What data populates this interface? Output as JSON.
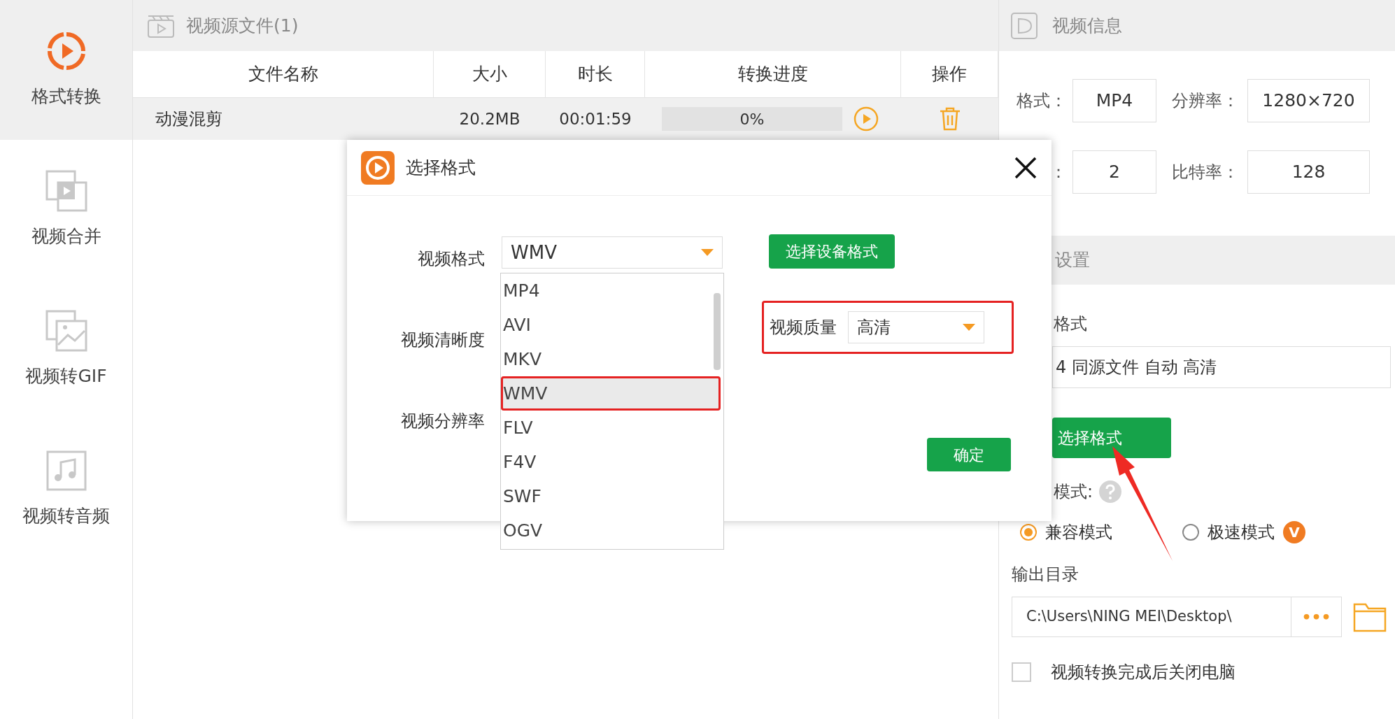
{
  "sidebar": {
    "items": [
      {
        "label": "格式转换",
        "kind": "convert",
        "selected": true
      },
      {
        "label": "视频合并",
        "kind": "merge",
        "selected": false
      },
      {
        "label": "视频转GIF",
        "kind": "gif",
        "selected": false
      },
      {
        "label": "视频转音频",
        "kind": "audio",
        "selected": false
      }
    ]
  },
  "source_panel": {
    "title": "视频源文件(1)",
    "columns": [
      "文件名称",
      "大小",
      "时长",
      "转换进度",
      "操作"
    ],
    "rows": [
      {
        "name": "动漫混剪",
        "size": "20.2MB",
        "duration": "00:01:59",
        "progress": "0%",
        "level": 0
      }
    ]
  },
  "info_panel": {
    "title": "视频信息",
    "fields": [
      {
        "label": "格式：",
        "value": "MP4"
      },
      {
        "label": "分辨率：",
        "value": "1280×720"
      },
      {
        "label": "：",
        "value": "2"
      },
      {
        "label": "比特率：",
        "value": "128"
      }
    ]
  },
  "output_settings": {
    "title": "设置",
    "format_label": "格式",
    "format_value": "4 同源文件 自动 高清",
    "choose_button": "选择格式",
    "mode_label": "模式:",
    "modes": [
      {
        "label": "兼容模式",
        "selected": true
      },
      {
        "label": "极速模式",
        "selected": false,
        "badge": "V"
      }
    ],
    "dir_label": "输出目录",
    "dir_value": "C:\\Users\\NING MEI\\Desktop\\",
    "dir_button": "•••",
    "shutdown": {
      "label": "视频转换完成后关闭电脑",
      "checked": false
    }
  },
  "dialog": {
    "title": "选择格式",
    "format_label": "视频格式",
    "format_value": "WMV",
    "clarity_label": "视频清晰度",
    "resolution_label": "视频分辨率",
    "device_button": "选择设备格式",
    "options": [
      {
        "label": "MP4",
        "selected": false
      },
      {
        "label": "AVI",
        "selected": false
      },
      {
        "label": "MKV",
        "selected": false
      },
      {
        "label": "WMV",
        "selected": true
      },
      {
        "label": "FLV",
        "selected": false
      },
      {
        "label": "F4V",
        "selected": false
      },
      {
        "label": "SWF",
        "selected": false
      },
      {
        "label": "OGV",
        "selected": false
      }
    ],
    "quality_label": "视频质量",
    "quality_value": "高清",
    "ok_button": "确定"
  }
}
